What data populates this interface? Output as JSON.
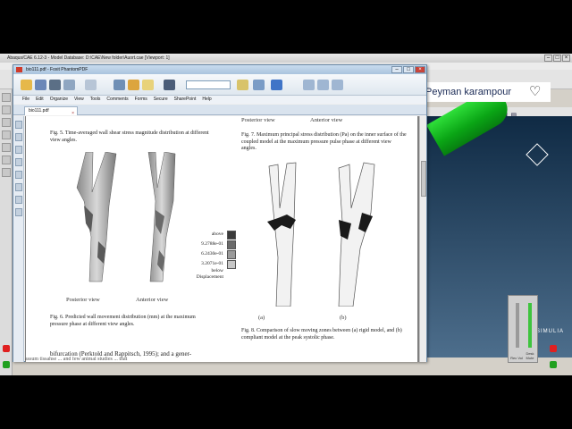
{
  "abaqus": {
    "title": "Abaqus/CAE 6.12-3 - Model Database: D:\\CAE\\New folder\\Auort.cae [Viewport: 1]",
    "bottom_text": "assum tissahse ... and few animal studies ... that"
  },
  "overlay": {
    "name": "Peyman karampour"
  },
  "foxit": {
    "title": "bio111.pdf - Foxit PhantomPDF",
    "menu": [
      "File",
      "Edit",
      "Organize",
      "View",
      "Tools",
      "Comments",
      "Forms",
      "Secure",
      "SharePoint",
      "Help"
    ],
    "tab_label": "bio111.pdf",
    "zoom_value": ""
  },
  "page": {
    "fig5_caption": "Fig. 5.  Time-averaged wall shear stress magnitude distribution at different view angles.",
    "fig6_caption": "Fig. 6.  Predicted wall movement distribution (mm) at the maximum pressure phase at different view angles.",
    "fig7_caption": "Fig. 7.  Maximum principal stress distribution (Pa) on the inner surface of the coupled model at the maximum pressure pulse phase at different view angles.",
    "fig8_caption": "Fig. 8.  Comparison of slow moving zones between (a) rigid model, and (b) compliant model at the peak systolic phase.",
    "top_left_views": [
      "Posterior view",
      "Anterior view"
    ],
    "fig6_views": [
      "Posterior view",
      "Anterior view"
    ],
    "sublabels": [
      "(a)",
      "(b)"
    ],
    "body_text": "bifurcation (Perktold and Rappitsch, 1995); and a gener-",
    "legend": {
      "items": [
        "above",
        "9.2788e-01",
        "6.2430e-01",
        "3.2071e-01",
        "below"
      ],
      "footer": "Displacement"
    }
  },
  "colors": {
    "accent": "#0aa515",
    "foxit_title": "#a9c3dd"
  }
}
